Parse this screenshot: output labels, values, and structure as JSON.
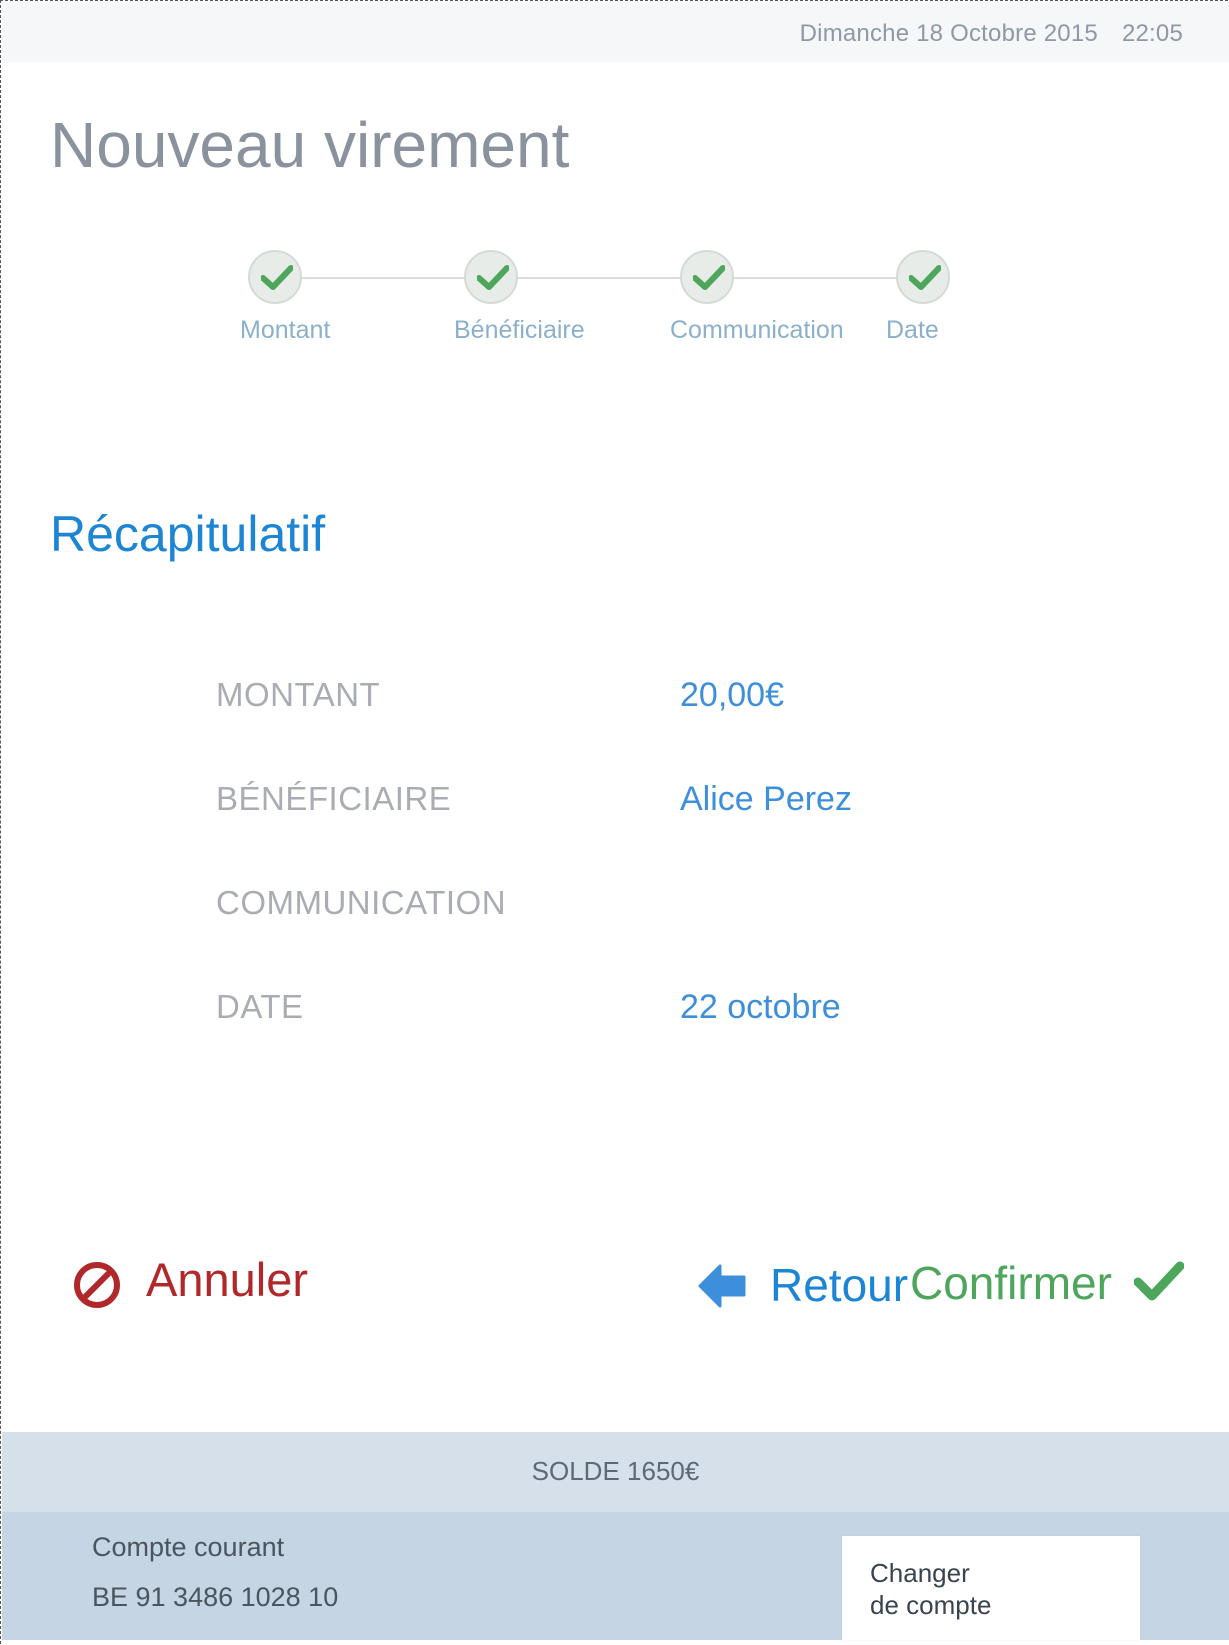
{
  "header": {
    "date": "Dimanche 18 Octobre 2015",
    "time": "22:05"
  },
  "page_title": "Nouveau virement",
  "stepper": {
    "steps": [
      {
        "label": "Montant",
        "status": "complete"
      },
      {
        "label": "Bénéficiaire",
        "status": "complete"
      },
      {
        "label": "Communication",
        "status": "complete"
      },
      {
        "label": "Date",
        "status": "complete"
      }
    ]
  },
  "summary": {
    "title": "Récapitulatif",
    "rows": [
      {
        "key": "MONTANT",
        "value": "20,00€"
      },
      {
        "key": "BÉNÉFICIAIRE",
        "value": "Alice Perez"
      },
      {
        "key": "COMMUNICATION",
        "value": ""
      },
      {
        "key": "DATE",
        "value": "22 octobre"
      }
    ]
  },
  "actions": {
    "cancel_label": "Annuler",
    "back_label": "Retour",
    "confirm_label": "Confirmer"
  },
  "footer": {
    "balance": "SOLDE 1650€",
    "account_name": "Compte courant",
    "account_iban": "BE 91 3486 1028 10",
    "change_account_line1": "Changer",
    "change_account_line2": "de compte"
  },
  "colors": {
    "accent_blue": "#1d86d4",
    "value_blue": "#3d8fdb",
    "cancel_red": "#b0282a",
    "confirm_green": "#4ea55c",
    "step_label": "#8ab0cb"
  },
  "icons": {
    "step_complete": "check-icon",
    "cancel": "no-entry-icon",
    "back": "arrow-left-icon",
    "confirm": "check-icon"
  }
}
